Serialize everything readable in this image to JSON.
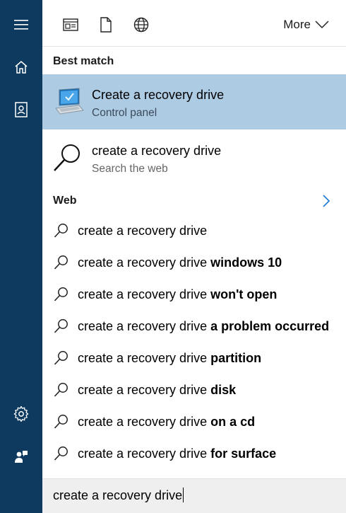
{
  "rail": {
    "items": [
      "hamburger-icon",
      "home-icon",
      "notebook-icon",
      "gear-icon",
      "feedback-icon"
    ]
  },
  "topbar": {
    "filter_icons": [
      "apps-filter-icon",
      "documents-filter-icon",
      "web-filter-icon"
    ],
    "more_label": "More"
  },
  "best_match": {
    "heading": "Best match",
    "title": "Create a recovery drive",
    "subtitle": "Control panel",
    "highlight_color": "#aecbe4"
  },
  "web_result": {
    "title": "create a recovery drive",
    "subtitle": "Search the web"
  },
  "web_section": {
    "heading": "Web"
  },
  "suggestions": [
    {
      "prefix": "create a recovery drive",
      "suffix": ""
    },
    {
      "prefix": "create a recovery drive ",
      "suffix": "windows 10"
    },
    {
      "prefix": "create a recovery drive ",
      "suffix": "won't open"
    },
    {
      "prefix": "create a recovery drive ",
      "suffix": "a problem occurred"
    },
    {
      "prefix": "create a recovery drive ",
      "suffix": "partition"
    },
    {
      "prefix": "create a recovery drive ",
      "suffix": "disk"
    },
    {
      "prefix": "create a recovery drive ",
      "suffix": "on a cd"
    },
    {
      "prefix": "create a recovery drive ",
      "suffix": "for surface"
    }
  ],
  "search": {
    "value": "create a recovery drive"
  },
  "colors": {
    "rail": "#0e3a5f",
    "accent": "#0078d7"
  }
}
